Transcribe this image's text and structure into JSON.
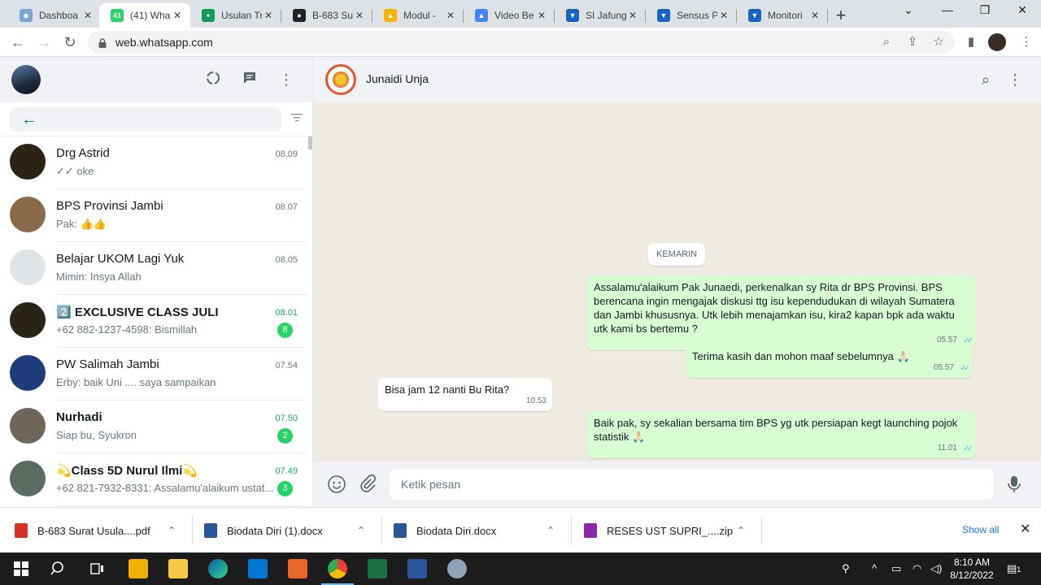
{
  "browser": {
    "tabs": [
      {
        "label": "Dashboa",
        "color": "#7aa3d6",
        "glyph": "◆"
      },
      {
        "label": "(41) Wha",
        "color": "#25d366",
        "glyph": "41",
        "active": true
      },
      {
        "label": "Usulan Tr",
        "color": "#0f9d58",
        "glyph": "+"
      },
      {
        "label": "B-683 Su",
        "color": "#202124",
        "glyph": "●"
      },
      {
        "label": "Modul -",
        "color": "#f4b400",
        "glyph": "▲"
      },
      {
        "label": "Video Be",
        "color": "#4285f4",
        "glyph": "▲"
      },
      {
        "label": "SI Jafung",
        "color": "#1565c0",
        "glyph": "▼"
      },
      {
        "label": "Sensus P",
        "color": "#1565c0",
        "glyph": "▼"
      },
      {
        "label": "Monitori",
        "color": "#1565c0",
        "glyph": "▼"
      }
    ],
    "url": "web.whatsapp.com"
  },
  "sidebar": {
    "search_placeholder": "",
    "chats": [
      {
        "name": "Drg Astrid",
        "time": "08.09",
        "preview": "✓✓ oke",
        "bold": false,
        "badge": "",
        "avatar": "#2b2416"
      },
      {
        "name": "BPS Provinsi Jambi",
        "time": "08.07",
        "preview": "Pak: 👍👍",
        "bold": false,
        "badge": "",
        "avatar": "#8a6a4c"
      },
      {
        "name": "Belajar UKOM Lagi Yuk",
        "time": "08.05",
        "preview": "Mimin: Insya Allah",
        "bold": false,
        "badge": "",
        "avatar": "#dfe5e7"
      },
      {
        "name": "2️⃣ EXCLUSIVE CLASS JULI",
        "time": "08.01",
        "preview": "+62 882-1237-4598: Bismillah",
        "bold": true,
        "badge": "8",
        "avatar": "#2a2418"
      },
      {
        "name": "PW Salimah Jambi",
        "time": "07.54",
        "preview": "Erby: baik Uni .... saya sampaikan",
        "bold": false,
        "badge": "",
        "avatar": "#1f3b7a"
      },
      {
        "name": "Nurhadi",
        "time": "07.50",
        "preview": "Siap bu, Syukron",
        "bold": true,
        "badge": "2",
        "avatar": "#6f665a"
      },
      {
        "name": "💫Class 5D Nurul Ilmi💫",
        "time": "07.49",
        "preview": "+62 821-7932-8331: Assalamu'alaikum ustat...",
        "bold": true,
        "badge": "3",
        "avatar": "#5a6b62"
      }
    ]
  },
  "conversation": {
    "contact_name": "Junaidi Unja",
    "day_label": "KEMARIN",
    "messages": [
      {
        "dir": "out",
        "text": "Assalamu'alaikum Pak Junaedi, perkenalkan sy Rita dr BPS Provinsi. BPS berencana ingin mengajak diskusi ttg isu kependudukan di wilayah Sumatera dan Jambi khususnya. Utk lebih menajamkan isu, kira2 kapan bpk ada waktu utk kami bs bertemu ?",
        "time": "05.57",
        "ticks": "✓✓"
      },
      {
        "dir": "out",
        "text": "Terima kasih dan mohon maaf sebelumnya 🙏🏻",
        "time": "05.57",
        "ticks": "✓✓"
      },
      {
        "dir": "in",
        "text": "Bisa jam 12 nanti Bu Rita?",
        "time": "10.53",
        "ticks": ""
      },
      {
        "dir": "out",
        "text": "Baik pak, sy sekalian bersama tim BPS yg utk persiapan kegt launching pojok statistik 🙏🏻",
        "time": "11.01",
        "ticks": "✓✓"
      }
    ],
    "composer_placeholder": "Ketik pesan"
  },
  "downloads": {
    "items": [
      {
        "name": "B-683 Surat Usula....pdf",
        "color": "#d93025"
      },
      {
        "name": "Biodata Diri (1).docx",
        "color": "#2b579a"
      },
      {
        "name": "Biodata Diri.docx",
        "color": "#2b579a"
      },
      {
        "name": "RESES UST SUPRI_....zip",
        "color": "#8e24aa"
      }
    ],
    "show_all": "Show all"
  },
  "taskbar": {
    "time": "8:10 AM",
    "date": "8/12/2022",
    "notification_count": "1"
  }
}
